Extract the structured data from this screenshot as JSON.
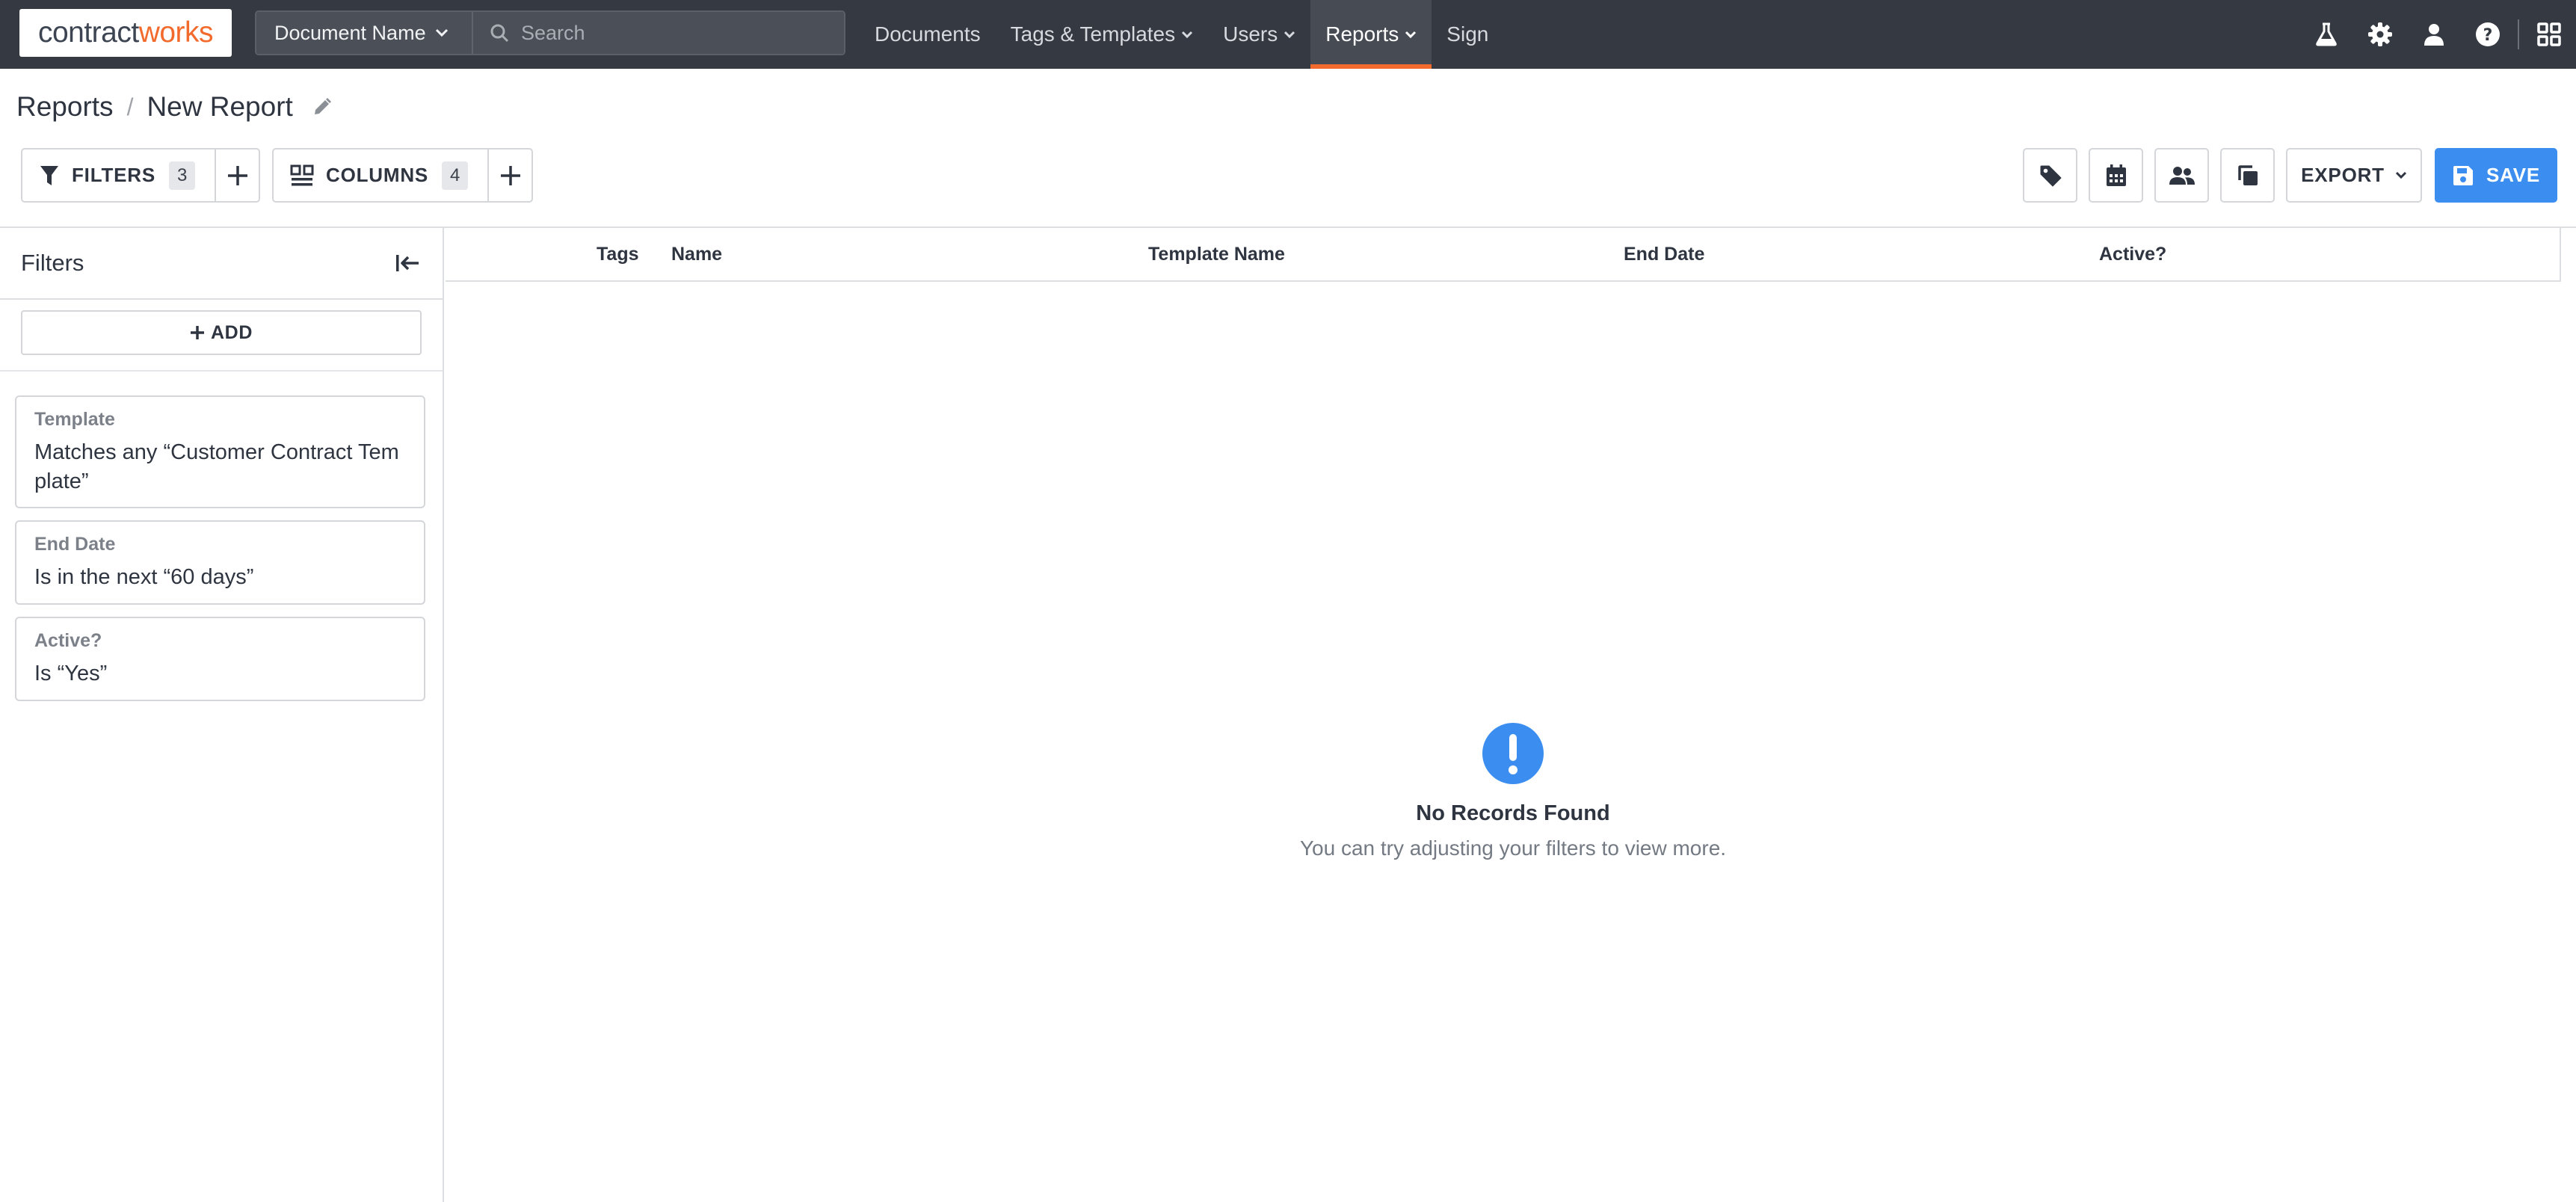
{
  "app": {
    "logo_part1": "contract",
    "logo_part2": "works"
  },
  "topnav": {
    "search_scope": "Document Name",
    "search_placeholder": "Search",
    "links": [
      {
        "label": "Documents",
        "has_dropdown": false
      },
      {
        "label": "Tags & Templates",
        "has_dropdown": true
      },
      {
        "label": "Users",
        "has_dropdown": true
      },
      {
        "label": "Reports",
        "has_dropdown": true,
        "active": true
      },
      {
        "label": "Sign",
        "has_dropdown": false
      }
    ],
    "icons": [
      "flask-icon",
      "gear-icon",
      "user-icon",
      "help-icon",
      "apps-grid-icon"
    ],
    "accent_color": "#f26b2d"
  },
  "breadcrumb": {
    "parent": "Reports",
    "separator": "/",
    "current": "New Report"
  },
  "toolbar": {
    "filters_label": "FILTERS",
    "filters_count": "3",
    "columns_label": "COLUMNS",
    "columns_count": "4",
    "export_label": "EXPORT",
    "save_label": "SAVE",
    "icon_buttons": [
      "tag-icon",
      "calendar-icon",
      "users-icon",
      "copy-icon"
    ],
    "save_color": "#3b8ef0"
  },
  "sidebar": {
    "title": "Filters",
    "add_label": "ADD",
    "filters": [
      {
        "label": "Template",
        "value": "Matches any “Customer Contract Template”"
      },
      {
        "label": "End Date",
        "value": "Is in the next “60 days”"
      },
      {
        "label": "Active?",
        "value": "Is “Yes”"
      }
    ]
  },
  "table": {
    "columns": [
      "Tags",
      "Name",
      "Template Name",
      "End Date",
      "Active?"
    ]
  },
  "empty_state": {
    "title": "No Records Found",
    "subtitle": "You can try adjusting your filters to view more.",
    "icon": "exclamation-circle-icon"
  }
}
